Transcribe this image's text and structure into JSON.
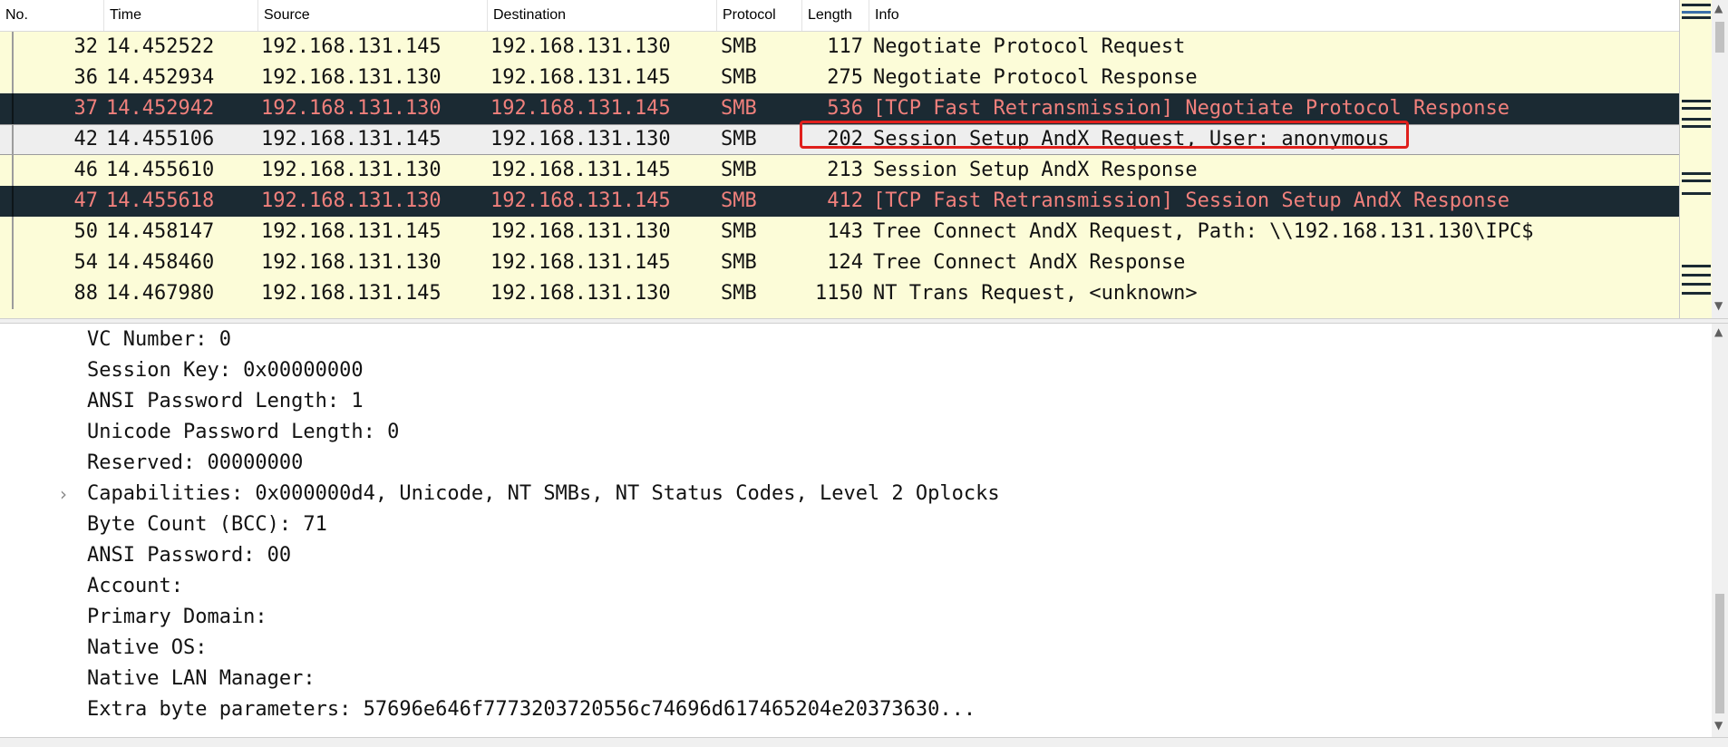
{
  "columns": {
    "no": "No.",
    "time": "Time",
    "source": "Source",
    "destination": "Destination",
    "protocol": "Protocol",
    "length": "Length",
    "info": "Info"
  },
  "packets": [
    {
      "no": "32",
      "time": "14.452522",
      "source": "192.168.131.145",
      "destination": "192.168.131.130",
      "protocol": "SMB",
      "length": "117",
      "info": "Negotiate Protocol Request",
      "style": "normal"
    },
    {
      "no": "36",
      "time": "14.452934",
      "source": "192.168.131.130",
      "destination": "192.168.131.145",
      "protocol": "SMB",
      "length": "275",
      "info": "Negotiate Protocol Response",
      "style": "normal"
    },
    {
      "no": "37",
      "time": "14.452942",
      "source": "192.168.131.130",
      "destination": "192.168.131.145",
      "protocol": "SMB",
      "length": "536",
      "info": "[TCP Fast Retransmission] Negotiate Protocol Response",
      "style": "dark"
    },
    {
      "no": "42",
      "time": "14.455106",
      "source": "192.168.131.145",
      "destination": "192.168.131.130",
      "protocol": "SMB",
      "length": "202",
      "info": "Session Setup AndX Request, User: anonymous",
      "style": "selected"
    },
    {
      "no": "46",
      "time": "14.455610",
      "source": "192.168.131.130",
      "destination": "192.168.131.145",
      "protocol": "SMB",
      "length": "213",
      "info": "Session Setup AndX Response",
      "style": "normal"
    },
    {
      "no": "47",
      "time": "14.455618",
      "source": "192.168.131.130",
      "destination": "192.168.131.145",
      "protocol": "SMB",
      "length": "412",
      "info": "[TCP Fast Retransmission] Session Setup AndX Response",
      "style": "dark"
    },
    {
      "no": "50",
      "time": "14.458147",
      "source": "192.168.131.145",
      "destination": "192.168.131.130",
      "protocol": "SMB",
      "length": "143",
      "info": "Tree Connect AndX Request, Path: \\\\192.168.131.130\\IPC$",
      "style": "normal"
    },
    {
      "no": "54",
      "time": "14.458460",
      "source": "192.168.131.130",
      "destination": "192.168.131.145",
      "protocol": "SMB",
      "length": "124",
      "info": "Tree Connect AndX Response",
      "style": "normal"
    },
    {
      "no": "88",
      "time": "14.467980",
      "source": "192.168.131.145",
      "destination": "192.168.131.130",
      "protocol": "SMB",
      "length": "1150",
      "info": "NT Trans Request, <unknown>",
      "style": "normal"
    }
  ],
  "details": [
    {
      "text": "VC Number: 0",
      "expandable": false
    },
    {
      "text": "Session Key: 0x00000000",
      "expandable": false
    },
    {
      "text": "ANSI Password Length: 1",
      "expandable": false
    },
    {
      "text": "Unicode Password Length: 0",
      "expandable": false
    },
    {
      "text": "Reserved: 00000000",
      "expandable": false
    },
    {
      "text": "Capabilities: 0x000000d4, Unicode, NT SMBs, NT Status Codes, Level 2 Oplocks",
      "expandable": true
    },
    {
      "text": "Byte Count (BCC): 71",
      "expandable": false
    },
    {
      "text": "ANSI Password: 00",
      "expandable": false
    },
    {
      "text": "Account:",
      "expandable": false
    },
    {
      "text": "Primary Domain:",
      "expandable": false
    },
    {
      "text": "Native OS:",
      "expandable": false
    },
    {
      "text": "Native LAN Manager:",
      "expandable": false
    },
    {
      "text": "Extra byte parameters: 57696e646f7773203720556c74696d617465204e20373630...",
      "expandable": false
    }
  ],
  "icons": {
    "expander": "chevron-right-icon",
    "scroll_up": "scroll-up-arrow-icon",
    "scroll_down": "scroll-down-arrow-icon"
  },
  "colors": {
    "row_normal_bg": "#fcfcd8",
    "row_dark_bg": "#1b2a33",
    "row_dark_fg": "#f0807c",
    "row_selected_bg": "#eeeeee",
    "annotation_red": "#e0201c"
  }
}
